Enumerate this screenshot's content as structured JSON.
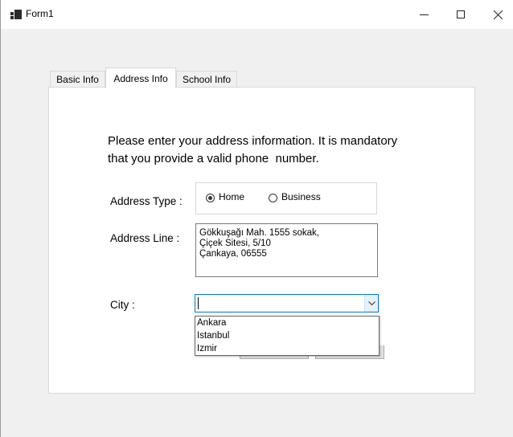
{
  "window": {
    "title": "Form1"
  },
  "tabs": [
    {
      "label": "Basic Info",
      "active": false
    },
    {
      "label": "Address Info",
      "active": true
    },
    {
      "label": "School Info",
      "active": false
    }
  ],
  "form": {
    "intro_line1": "Please enter your address information. It is mandatory",
    "intro_line2": "that you provide a valid phone  number.",
    "address_type_label": "Address Type :",
    "address_type_options": [
      {
        "label": "Home",
        "selected": true
      },
      {
        "label": "Business",
        "selected": false
      }
    ],
    "address_line_label": "Address Line :",
    "address_line_value": "Gökkuşağı Mah. 1555 sokak,\nÇiçek Sitesi, 5/10\nÇankaya, 06555",
    "city_label": "City :",
    "city_value": "",
    "city_options": [
      "Ankara",
      "Istanbul",
      "Izmir"
    ]
  },
  "icons": {
    "app": "form-app-icon",
    "minimize": "minimize-icon",
    "maximize": "maximize-icon",
    "close": "close-icon",
    "combo": "chevron-down-icon"
  },
  "colors": {
    "focus_border": "#0078d7",
    "tab_border": "#d9d9d9",
    "window_bg": "#f0f0f0"
  }
}
